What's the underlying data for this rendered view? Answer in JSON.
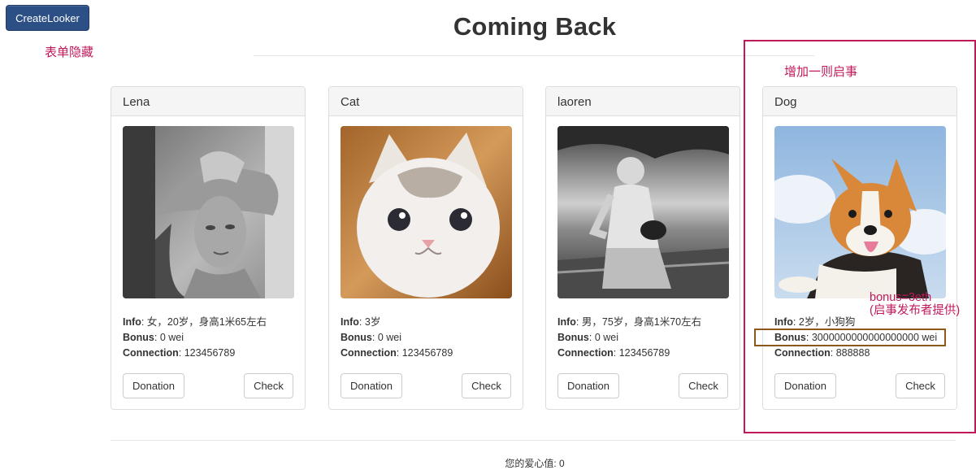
{
  "header": {
    "create_button": "CreateLooker",
    "hidden_note": "表单隐藏",
    "title": "Coming Back",
    "add_note": "增加一则启事"
  },
  "labels": {
    "info": "Info",
    "bonus": "Bonus",
    "connection": "Connection",
    "donation": "Donation",
    "check": "Check"
  },
  "cards": [
    {
      "name": "Lena",
      "info": "女，20岁，身高1米65左右",
      "bonus": "0 wei",
      "connection": "123456789"
    },
    {
      "name": "Cat",
      "info": "3岁",
      "bonus": "0 wei",
      "connection": "123456789"
    },
    {
      "name": "laoren",
      "info": "男，75岁，身高1米70左右",
      "bonus": "0 wei",
      "connection": "123456789"
    },
    {
      "name": "Dog",
      "info": "2岁，小狗狗",
      "bonus": "3000000000000000000 wei",
      "connection": "888888"
    }
  ],
  "annotation": {
    "line1": "bonus=3eth",
    "line2": "(启事发布者提供)"
  },
  "footer": {
    "love_label": "您的爱心值: 0"
  }
}
